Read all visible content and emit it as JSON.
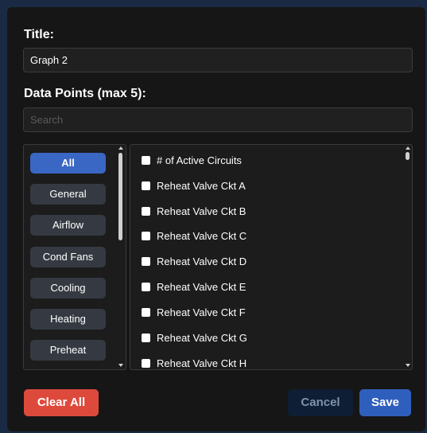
{
  "title_label": "Title:",
  "title_value": "Graph 2",
  "data_points_label": "Data Points (max 5):",
  "search_placeholder": "Search",
  "categories": [
    "All",
    "General",
    "Airflow",
    "Cond Fans",
    "Cooling",
    "Heating",
    "Preheat"
  ],
  "active_category": "All",
  "data_points": [
    "# of Active Circuits",
    "Reheat Valve Ckt A",
    "Reheat Valve Ckt B",
    "Reheat Valve Ckt C",
    "Reheat Valve Ckt D",
    "Reheat Valve Ckt E",
    "Reheat Valve Ckt F",
    "Reheat Valve Ckt G",
    "Reheat Valve Ckt H"
  ],
  "buttons": {
    "clear_all": "Clear All",
    "cancel": "Cancel",
    "save": "Save"
  },
  "colors": {
    "accent": "#3a67c4",
    "danger": "#dd4a3c",
    "cancel_bg": "#0e1e34"
  }
}
